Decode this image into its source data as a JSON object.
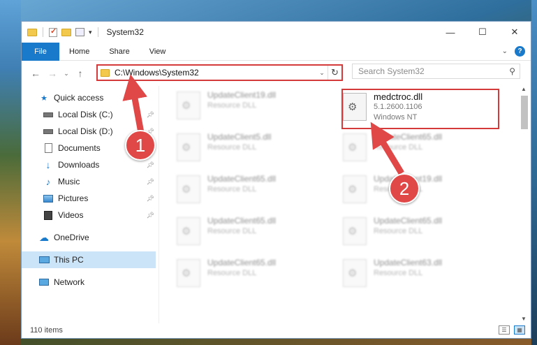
{
  "window": {
    "title": "System32",
    "controls": {
      "minimize": "—",
      "maximize": "☐",
      "close": "✕"
    }
  },
  "ribbon": {
    "tabs": [
      "File",
      "Home",
      "Share",
      "View"
    ],
    "help": "?"
  },
  "nav": {
    "address": "C:\\Windows\\System32",
    "search_placeholder": "Search System32"
  },
  "sidebar": {
    "items": [
      {
        "label": "Quick access",
        "icon": "star-icon",
        "pinned": false
      },
      {
        "label": "Local Disk (C:)",
        "icon": "drive-icon",
        "pinned": true
      },
      {
        "label": "Local Disk (D:)",
        "icon": "drive-icon",
        "pinned": true
      },
      {
        "label": "Documents",
        "icon": "document-icon",
        "pinned": true
      },
      {
        "label": "Downloads",
        "icon": "download-icon",
        "pinned": true
      },
      {
        "label": "Music",
        "icon": "music-icon",
        "pinned": true
      },
      {
        "label": "Pictures",
        "icon": "pictures-icon",
        "pinned": true
      },
      {
        "label": "Videos",
        "icon": "video-icon",
        "pinned": true
      },
      {
        "label": "OneDrive",
        "icon": "cloud-icon",
        "pinned": false
      },
      {
        "label": "This PC",
        "icon": "computer-icon",
        "pinned": false,
        "selected": true
      },
      {
        "label": "Network",
        "icon": "network-icon",
        "pinned": false
      }
    ]
  },
  "files": {
    "left_column": [
      {
        "name": "UpdateClient19.dll",
        "type": "Resource DLL"
      },
      {
        "name": "UpdateClient5.dll",
        "type": "Resource DLL"
      },
      {
        "name": "UpdateClient65.dll",
        "type": "Resource DLL"
      },
      {
        "name": "UpdateClient65.dll",
        "type": "Resource DLL"
      },
      {
        "name": "UpdateClient65.dll",
        "type": "Resource DLL"
      }
    ],
    "right_column": [
      {
        "name": "UpdateClient65.dll",
        "type": "Resource DLL"
      },
      {
        "name": "UpdateClient19.dll",
        "type": "Resource DLL"
      },
      {
        "name": "UpdateClient65.dll",
        "type": "Resource DLL"
      },
      {
        "name": "UpdateClient63.dll",
        "type": "Resource DLL"
      }
    ],
    "highlighted": {
      "name": "medctroc.dll",
      "version": "5.1.2600.1106",
      "company": "Windows NT"
    }
  },
  "status": {
    "item_count": "110 items"
  },
  "callouts": {
    "first": "1",
    "second": "2"
  },
  "colors": {
    "accent": "#1979ca",
    "highlight": "#d43a3a",
    "selected": "#cce4f7"
  }
}
